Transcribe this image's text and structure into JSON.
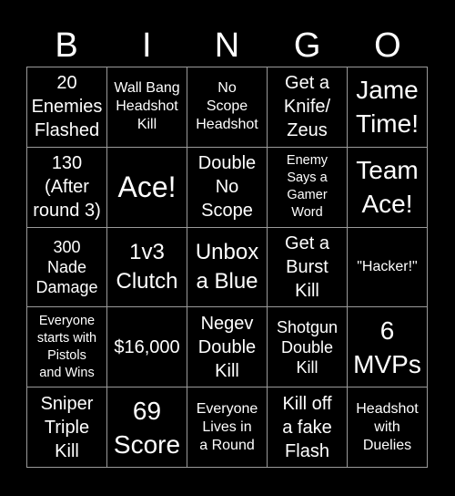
{
  "header": {
    "letters": [
      "B",
      "I",
      "N",
      "G",
      "O"
    ]
  },
  "cells": [
    [
      "20\nEnemies\nFlashed",
      "Wall Bang\nHeadshot\nKill",
      "No\nScope\nHeadshot",
      "Get a\nKnife/\nZeus",
      "Jame\nTime!"
    ],
    [
      "130\n(After\nround 3)",
      "Ace!",
      "Double\nNo\nScope",
      "Enemy\nSays a\nGamer\nWord",
      "Team\nAce!"
    ],
    [
      "300\nNade\nDamage",
      "1v3\nClutch",
      "Unbox\na Blue",
      "Get a\nBurst\nKill",
      "\"Hacker!\""
    ],
    [
      "Everyone\nstarts with\nPistols\nand Wins",
      "$16,000",
      "Negev\nDouble\nKill",
      "Shotgun\nDouble\nKill",
      "6\nMVPs"
    ],
    [
      "Sniper\nTriple\nKill",
      "69\nScore",
      "Everyone\nLives in\na Round",
      "Kill off\na fake\nFlash",
      "Headshot\nwith\nDuelies"
    ]
  ],
  "colors": {
    "background": "#000000",
    "text": "#ffffff",
    "grid_line": "#9a9a9a"
  }
}
